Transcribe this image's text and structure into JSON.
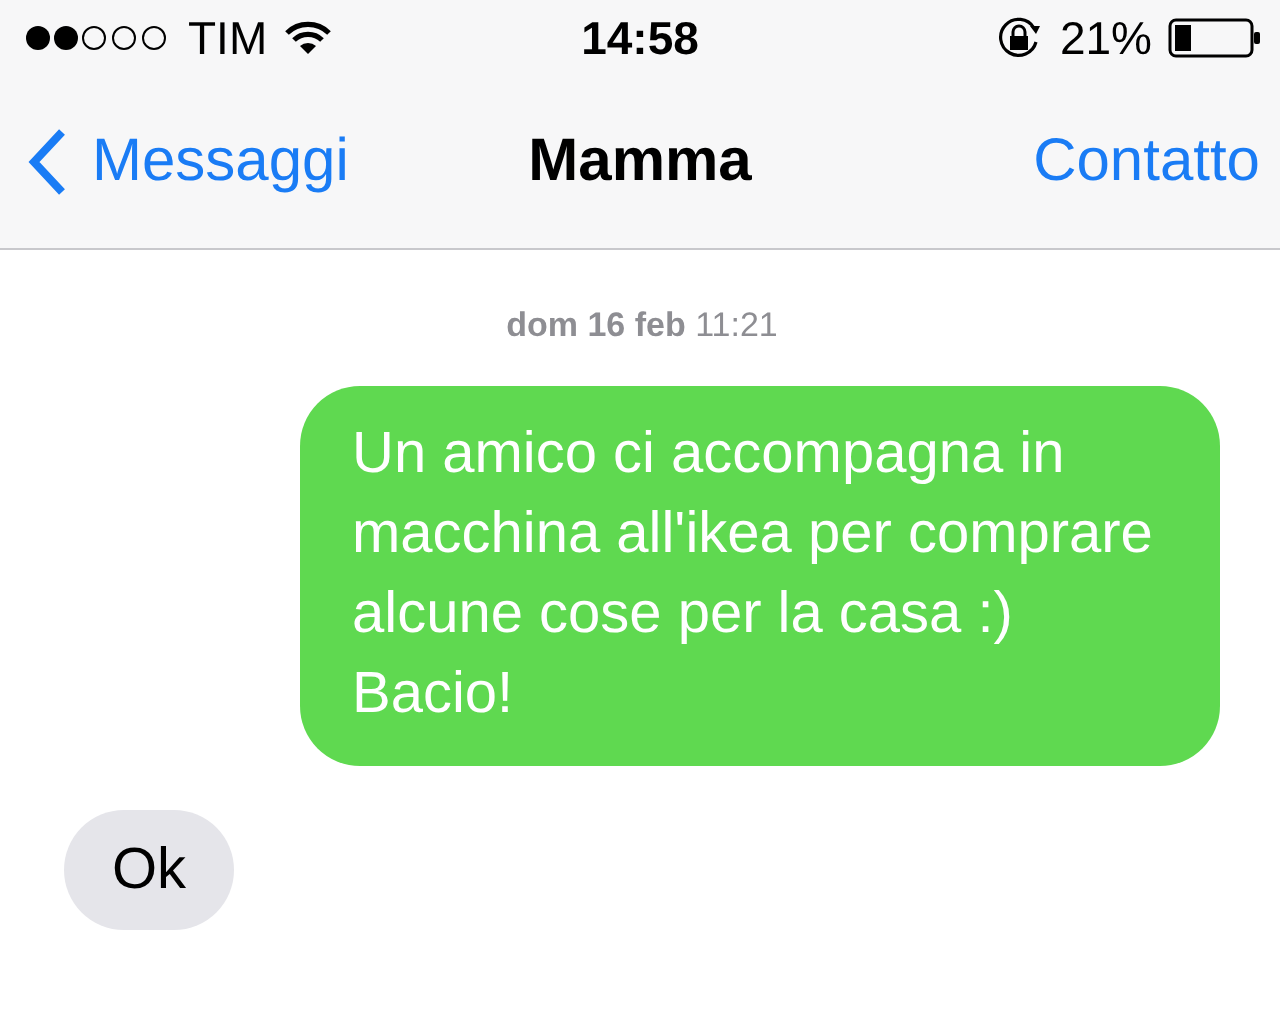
{
  "status_bar": {
    "carrier": "TIM",
    "time": "14:58",
    "battery": "21%"
  },
  "nav_bar": {
    "back": "Messaggi",
    "title": "Mamma",
    "action": "Contatto"
  },
  "timestamp": "**dom 16 feb** 11:21",
  "messages": [
    {
      "kind": "sent",
      "text": "Un amico ci accompagna in macchina all'ikea per comprare alcune cose per la casa :) Bacio!"
    },
    {
      "kind": "received",
      "text": "Ok"
    }
  ]
}
